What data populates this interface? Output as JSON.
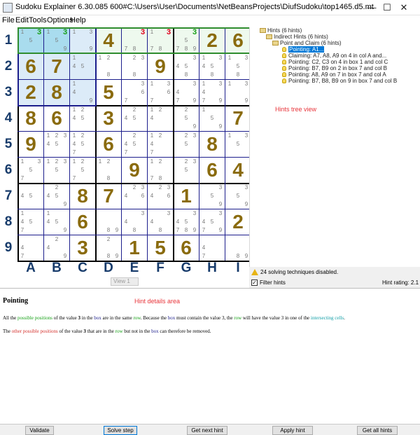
{
  "window": {
    "title": "Sudoku Explainer 6.30.085     600#C:\\Users\\User\\Documents\\NetBeansProjects\\DiufSudoku\\top1465.d5.mt",
    "minimize": "—",
    "maximize": "☐",
    "close": "✕"
  },
  "menu": [
    "File",
    "Edit",
    "Tools",
    "Options",
    "Help"
  ],
  "row_labels": [
    "1",
    "2",
    "3",
    "4",
    "5",
    "6",
    "7",
    "8",
    "9"
  ],
  "col_labels": [
    "A",
    "B",
    "C",
    "D",
    "E",
    "F",
    "G",
    "H",
    "I"
  ],
  "board": [
    [
      "c:1,3g,5",
      "c:1,3g,5,9",
      "c:1,3,9",
      "4",
      "c:3r,7,8",
      "c:1,3r,7,8",
      "c:3g,5,7,8,9",
      "2",
      "6"
    ],
    [
      "6",
      "7",
      "c:1,4,5",
      "c:1,2,8",
      "c:2,3,8",
      "9",
      "c:3,4,5,8",
      "c:1,3,4,5,8",
      "c:1,3,5,8"
    ],
    [
      "2",
      "8",
      "c:1,4,9",
      "5",
      "c:3,6,7",
      "c:1,3,6,7",
      "c:3,4,7,9",
      "c:1,3,4,7,9",
      "c:1,3,9"
    ],
    [
      "8",
      "6",
      "c:1,2,4,5",
      "3",
      "c:2,4,5",
      "c:1,2,4",
      "c:2,5,9",
      "c:1,5,9",
      "7"
    ],
    [
      "9",
      "c:1,2,3,4,5",
      "c:1,2,4,5,7",
      "6",
      "c:2,4,5,7",
      "c:1,2,4,7",
      "c:2,3,5",
      "8",
      "c:1,3,5"
    ],
    [
      "c:1,3,5,7",
      "c:1,2,3,5",
      "c:1,2,5,7",
      "c:1,2,8",
      "9",
      "c:1,2,7,8",
      "c:2,3,5",
      "6",
      "4"
    ],
    [
      "c:4,5",
      "c:2,4,5,9",
      "8",
      "7",
      "c:2,3,4,6",
      "c:2,3,4,6",
      "1",
      "c:3,5,9",
      "c:3,5,9"
    ],
    [
      "c:1,4,5,7",
      "c:1,4,5,9",
      "6",
      "c:8,9",
      "c:3,4,8",
      "c:3,4,8",
      "c:3,4,5,7,8,9",
      "c:3,4,5,7,9",
      "2"
    ],
    [
      "c:4,7",
      "c:2,4,9",
      "3",
      "c:2,8,9",
      "1",
      "5",
      "6",
      "c:4,7",
      "c:8,9"
    ]
  ],
  "tree": {
    "root": "Hints (6 hints)",
    "indirect": "Indirect Hints (6 hints)",
    "pointclaim": "Point and Claim (6 hints)",
    "items": [
      "Pointing: A1...",
      "Claiming: A7, A8, A9 on 4 in col A and...",
      "Pointing: C2, C3 on 4 in box 1 and col C",
      "Pointing: B7, B9 on 2 in box 7 and col B",
      "Pointing: A8, A9 on 7 in box 7 and col A",
      "Pointing: B7, B8, B9 on 9 in box 7 and col B"
    ]
  },
  "overlays": {
    "tree": "Hints tree view",
    "details": "Hint details area"
  },
  "view_combo": "View 1",
  "status": {
    "disabled": "24 solving techniques disabled.",
    "filter": "Filter hints",
    "filter_checked": "✓",
    "rating": "Hint rating:  2.1"
  },
  "details": {
    "title": "Pointing",
    "line1": [
      {
        "t": "All the ",
        "c": ""
      },
      {
        "t": "possible positions",
        "c": "c-green"
      },
      {
        "t": " of the value ",
        "c": ""
      },
      {
        "t": "3",
        "c": "b"
      },
      {
        "t": " in the ",
        "c": ""
      },
      {
        "t": "box",
        "c": "c-blue"
      },
      {
        "t": " are in the same ",
        "c": ""
      },
      {
        "t": "row",
        "c": "c-green"
      },
      {
        "t": ". Because the ",
        "c": ""
      },
      {
        "t": "box",
        "c": "c-blue"
      },
      {
        "t": " must contain the value 3, the ",
        "c": ""
      },
      {
        "t": "row",
        "c": "c-green"
      },
      {
        "t": " will have the value 3 in one of the ",
        "c": ""
      },
      {
        "t": "intersecting cells",
        "c": "c-cyan"
      },
      {
        "t": ".",
        "c": ""
      }
    ],
    "line2": [
      {
        "t": "The ",
        "c": ""
      },
      {
        "t": "other possible positions",
        "c": "c-red"
      },
      {
        "t": " of the value ",
        "c": ""
      },
      {
        "t": "3",
        "c": "b"
      },
      {
        "t": " that are in the ",
        "c": ""
      },
      {
        "t": "row",
        "c": "c-green"
      },
      {
        "t": " but not in the ",
        "c": ""
      },
      {
        "t": "box",
        "c": "c-blue"
      },
      {
        "t": " can therefore be removed.",
        "c": ""
      }
    ]
  },
  "buttons": {
    "validate": "Validate",
    "solve": "Solve step",
    "next": "Get next hint",
    "apply": "Apply hint",
    "all": "Get all hints"
  }
}
